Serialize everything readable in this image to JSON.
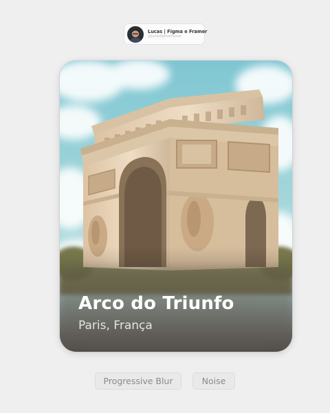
{
  "author": {
    "name": "Lucas | Figma e Framer",
    "subtitle": "@lucasfigmaframer"
  },
  "card": {
    "title": "Arco do Triunfo",
    "subtitle": "Paris, França",
    "image": "arc-de-triomphe-photo"
  },
  "effects": {
    "progressive_blur_label": "Progressive Blur",
    "noise_label": "Noise"
  },
  "colors": {
    "page_background": "#efefef",
    "sky": "#7fc6d2",
    "stone": "#e4cfb0",
    "chip_background": "#e9e9e9"
  }
}
